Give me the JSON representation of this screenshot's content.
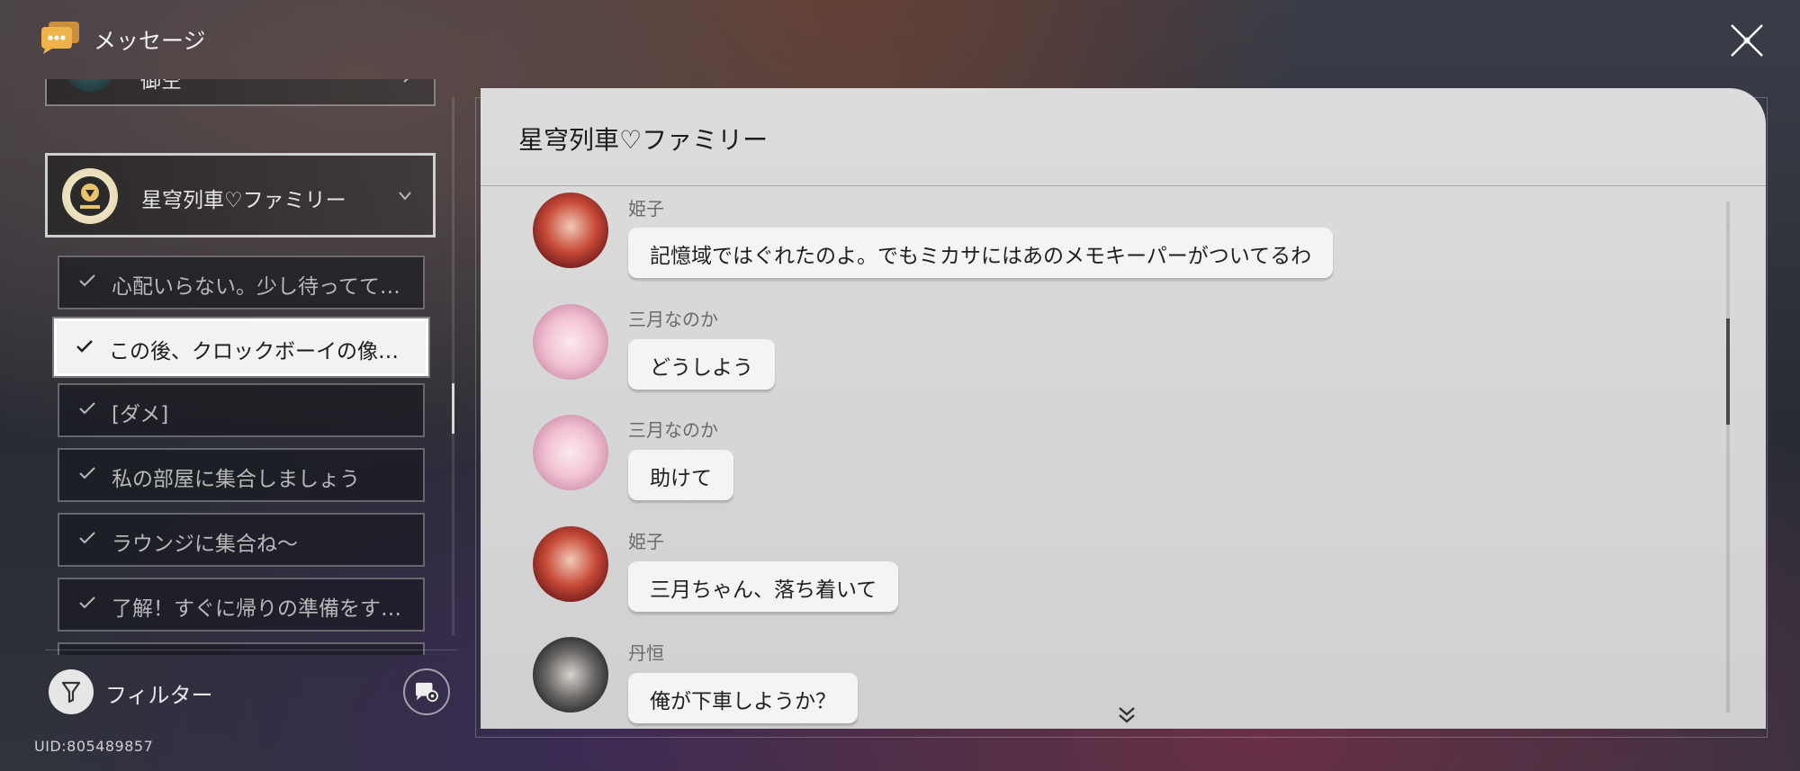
{
  "header": {
    "title": "メッセージ",
    "icon": "chat-bubble-icon",
    "close_icon": "close-icon"
  },
  "contacts": {
    "partial_top": {
      "name": "御空"
    },
    "selected": {
      "name": "星穹列車♡ファミリー"
    }
  },
  "threads": [
    {
      "label": "心配いらない。少し待ってて…",
      "active": false
    },
    {
      "label": "この後、クロックボーイの像…",
      "active": true
    },
    {
      "label": "[ダメ]",
      "active": false
    },
    {
      "label": "私の部屋に集合しましょう",
      "active": false
    },
    {
      "label": "ラウンジに集合ね～",
      "active": false
    },
    {
      "label": "了解！すぐに帰りの準備をす…",
      "active": false
    }
  ],
  "footer": {
    "filter_label": "フィルター",
    "uid": "UID:805489857"
  },
  "chat": {
    "title": "星穹列車♡ファミリー",
    "messages": [
      {
        "sender": "姫子",
        "text": "記憶域ではぐれたのよ。でもミカサにはあのメモキーパーがついてるわ"
      },
      {
        "sender": "三月なのか",
        "text": "どうしよう"
      },
      {
        "sender": "三月なのか",
        "text": "助けて"
      },
      {
        "sender": "姫子",
        "text": "三月ちゃん、落ち着いて"
      },
      {
        "sender": "丹恒",
        "text": "俺が下車しようか？"
      }
    ]
  },
  "colors": {
    "panel_bg": "#d8d8d8",
    "bubble_bg": "#f4f4f4",
    "active_thread_bg": "#f2f2f2"
  }
}
